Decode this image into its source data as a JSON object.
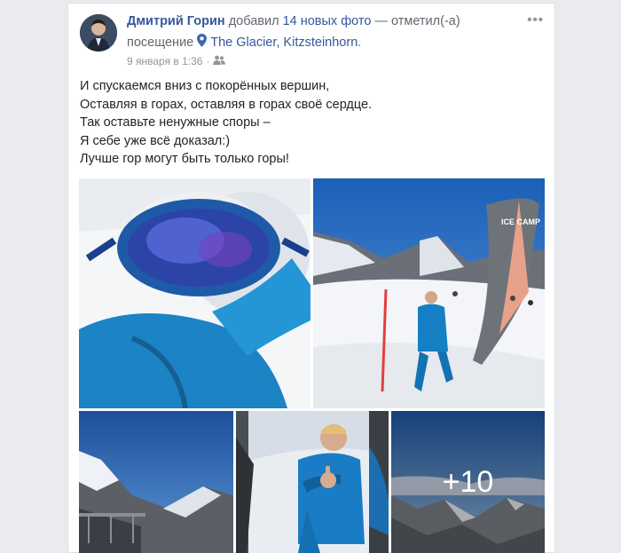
{
  "post": {
    "author": "Дмитрий Горин",
    "action_prefix": "добавил",
    "photos_link": "14 новых фото",
    "action_suffix": "— отметил(-а)",
    "visit_word": "посещение",
    "place": "The Glacier, Kitzsteinhorn",
    "place_end": ".",
    "timestamp": "9 января в 1:36",
    "audience_icon": "friends-icon",
    "more_label": "•••",
    "text_lines": [
      "И спускаемся вниз с покорённых вершин,",
      "Оставляя в горах, оставляя в горах своё сердце.",
      "Так оставьте ненужные споры –",
      "Я себе уже всё доказал:)",
      "Лучше гор могут быть только горы!"
    ],
    "more_photos_label": "+10",
    "photos": [
      {
        "name": "photo-goggles-selfie",
        "alt": "ski goggles selfie"
      },
      {
        "name": "photo-ice-camp",
        "alt": "man at ice camp flag"
      },
      {
        "name": "photo-mountain-viewpoint",
        "alt": "mountain viewpoint"
      },
      {
        "name": "photo-skier-thumbs-up",
        "alt": "skier thumbs up"
      },
      {
        "name": "photo-mountain-panorama",
        "alt": "mountain panorama"
      }
    ],
    "flag_text": "ICE CAMP",
    "colors": {
      "link": "#365899",
      "muted": "#616770",
      "meta": "#90949c",
      "sky": "#1f5fb3"
    }
  }
}
